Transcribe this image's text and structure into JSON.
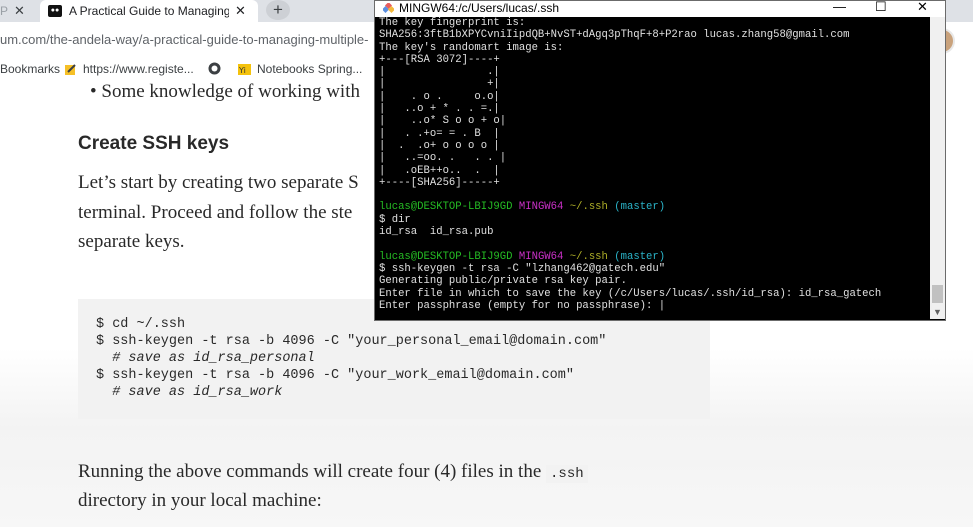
{
  "browser": {
    "tabs": [
      {
        "title": "P",
        "close": "✕"
      },
      {
        "title": "A Practical Guide to Managing M",
        "close": "✕"
      }
    ],
    "new_tab": "+",
    "url": "um.com/the-andela-way/a-practical-guide-to-managing-multiple-",
    "bookmarks": [
      {
        "label": "Bookmarks"
      },
      {
        "label": "https://www.registe..."
      },
      {
        "label": ""
      },
      {
        "label": "Notebooks Spring..."
      }
    ]
  },
  "article": {
    "bullet": "•  Some knowledge of working with",
    "heading": "Create SSH keys",
    "para": [
      "Let’s start by creating two separate S",
      "terminal. Proceed and follow the ste",
      "separate keys."
    ],
    "code": [
      "$ cd ~/.ssh",
      "$ ssh-keygen -t rsa -b 4096 -C \"your_personal_email@domain.com\"",
      "  # save as id_rsa_personal",
      "$ ssh-keygen -t rsa -b 4096 -C \"your_work_email@domain.com\"",
      "  # save as id_rsa_work"
    ],
    "bottom_line1_a": "Running the above commands will create four (4) files in the ",
    "bottom_inline_code": ".ssh",
    "bottom_line2": "directory in your local machine:"
  },
  "terminal": {
    "title": "MINGW64:/c/Users/lucas/.ssh",
    "minimize": "—",
    "maximize": "☐",
    "close": "✕",
    "lines": [
      "The key fingerprint is:",
      "SHA256:3ftB1bXPYCvniIipdQB+NvST+dAgq3pThqF+8+P2rao lucas.zhang58@gmail.com",
      "The key's randomart image is:",
      "+---[RSA 3072]----+",
      "|                .|",
      "|                +|",
      "|    . o .     o.o|",
      "|   ..o + * . . =.|",
      "|    ..o* S o o + o|",
      "|   . .+o= = . B  |",
      "|  .  .o+ o o o o |",
      "|   ..=oo. .   . . |",
      "|   .oEB++o..  .  |",
      "+----[SHA256]-----+",
      ""
    ],
    "prompt1": {
      "user": "lucas@DESKTOP-LBIJ9GD",
      "shell": "MINGW64",
      "path": "~/.ssh",
      "branch": "(master)"
    },
    "cmd1": "$ dir",
    "out1": "id_rsa  id_rsa.pub",
    "blank": "",
    "prompt2": {
      "user": "lucas@DESKTOP-LBIJ9GD",
      "shell": "MINGW64",
      "path": "~/.ssh",
      "branch": "(master)"
    },
    "cmd2": "$ ssh-keygen -t rsa -C \"lzhang462@gatech.edu\"",
    "out2": [
      "Generating public/private rsa key pair.",
      "Enter file in which to save the key (/c/Users/lucas/.ssh/id_rsa): id_rsa_gatech",
      "Enter passphrase (empty for no passphrase): |"
    ]
  },
  "colors": {
    "terminal_bg": "#000000",
    "prompt_user": "#25bc24",
    "prompt_shell": "#c930c7",
    "prompt_path": "#adad27",
    "prompt_branch": "#2bb4c9"
  }
}
